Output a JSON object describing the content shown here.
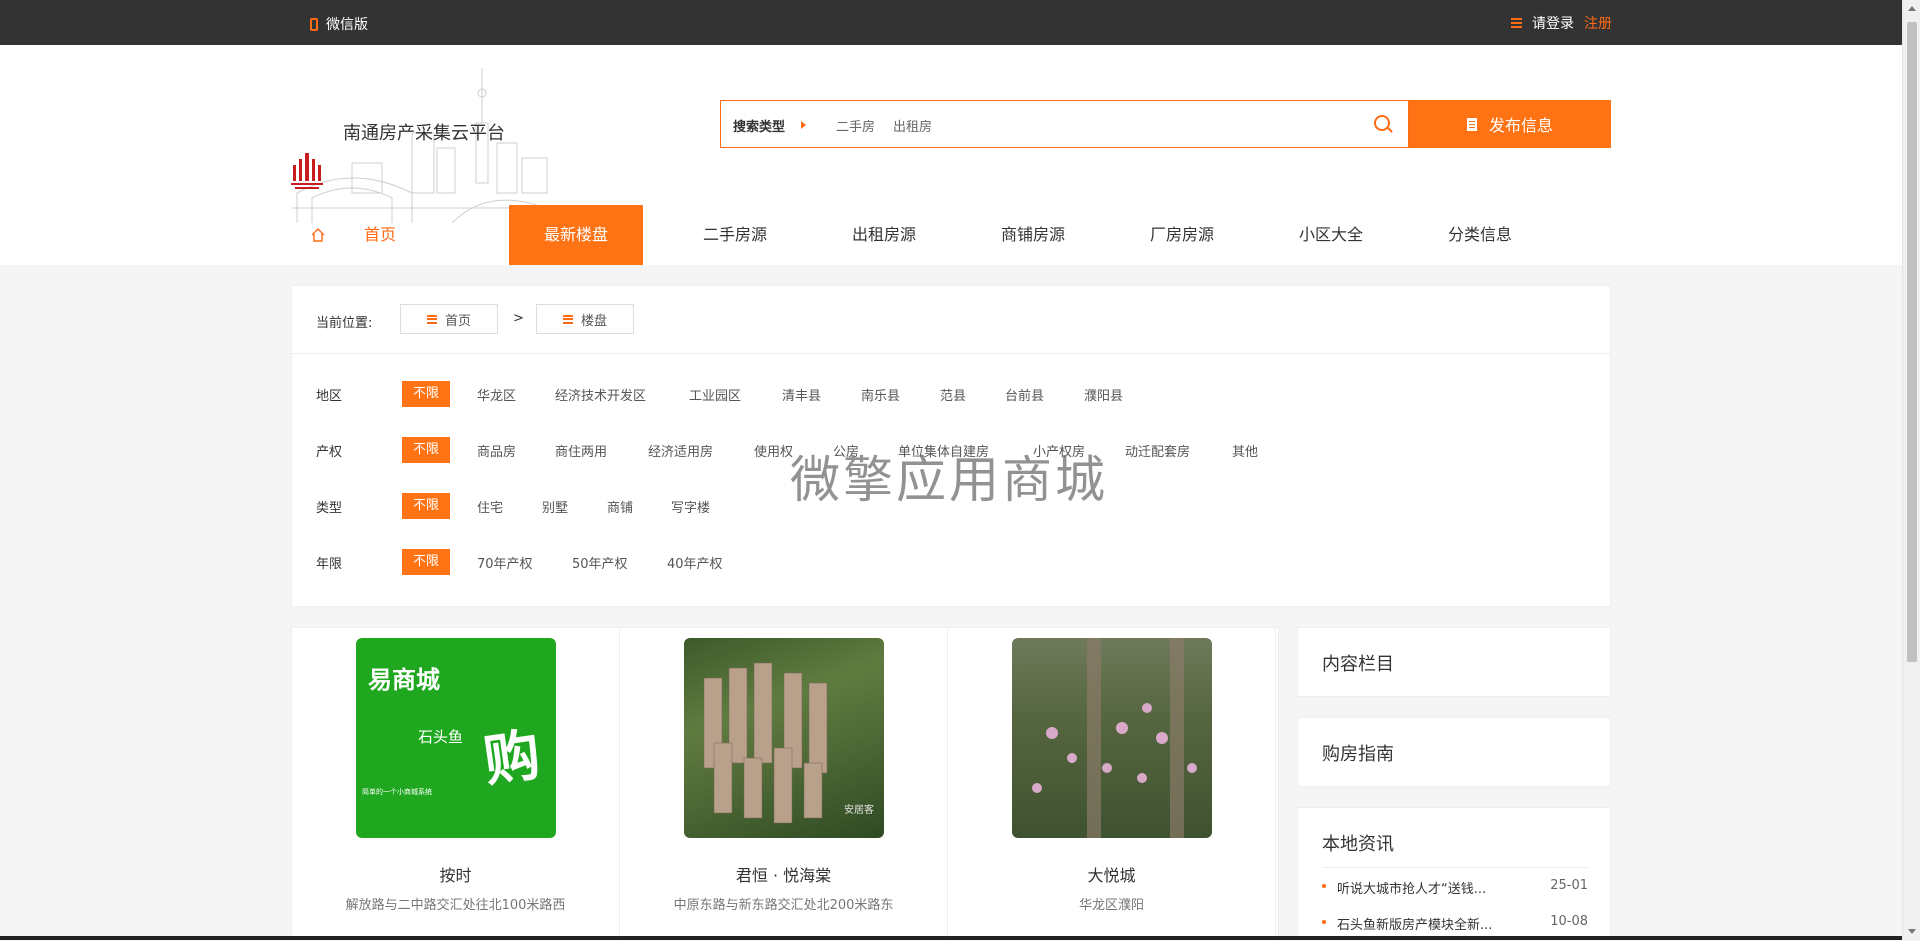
{
  "topbar": {
    "wechat_label": "微信版",
    "login_label": "请登录",
    "register_label": "注册"
  },
  "header": {
    "site_name": "南通房产采集云平台",
    "search": {
      "type_label": "搜索类型",
      "options": [
        "二手房",
        "出租房"
      ]
    },
    "publish_label": "发布信息"
  },
  "nav": {
    "items": [
      "首页",
      "最新楼盘",
      "二手房源",
      "出租房源",
      "商铺房源",
      "厂房房源",
      "小区大全",
      "分类信息"
    ]
  },
  "breadcrumb": {
    "label": "当前位置:",
    "items": [
      "首页",
      "楼盘"
    ],
    "separator": ">"
  },
  "filters": [
    {
      "label": "地区",
      "selected": "不限",
      "options": [
        "华龙区",
        "经济技术开发区",
        "工业园区",
        "清丰县",
        "南乐县",
        "范县",
        "台前县",
        "濮阳县"
      ]
    },
    {
      "label": "产权",
      "selected": "不限",
      "options": [
        "商品房",
        "商住两用",
        "经济适用房",
        "使用权",
        "公房",
        "单位集体自建房",
        "小产权房",
        "动迁配套房",
        "其他"
      ]
    },
    {
      "label": "类型",
      "selected": "不限",
      "options": [
        "住宅",
        "别墅",
        "商铺",
        "写字楼"
      ]
    },
    {
      "label": "年限",
      "selected": "不限",
      "options": [
        "70年产权",
        "50年产权",
        "40年产权"
      ]
    }
  ],
  "watermark": "微擎应用商城",
  "listings": [
    {
      "name": "按时",
      "address": "解放路与二中路交汇处往北100米路西",
      "image_text": {
        "brand": "易商城",
        "sub": "石头鱼",
        "tagline": "简单的一个小商城系统",
        "char": "购"
      }
    },
    {
      "name": "君恒 · 悦海棠",
      "address": "中原东路与新东路交汇处北200米路东",
      "image_text": {
        "watermark": "安居客"
      }
    },
    {
      "name": "大悦城",
      "address": "华龙区濮阳"
    }
  ],
  "sidebar": {
    "content_title": "内容栏目",
    "guide_title": "购房指南",
    "news_title": "本地资讯",
    "news": [
      {
        "title": "听说大城市抢人才“送钱...",
        "date": "25-01"
      },
      {
        "title": "石头鱼新版房产模块全新...",
        "date": "10-08"
      }
    ]
  },
  "colors": {
    "accent": "#ff7314",
    "topbar": "#333333"
  }
}
